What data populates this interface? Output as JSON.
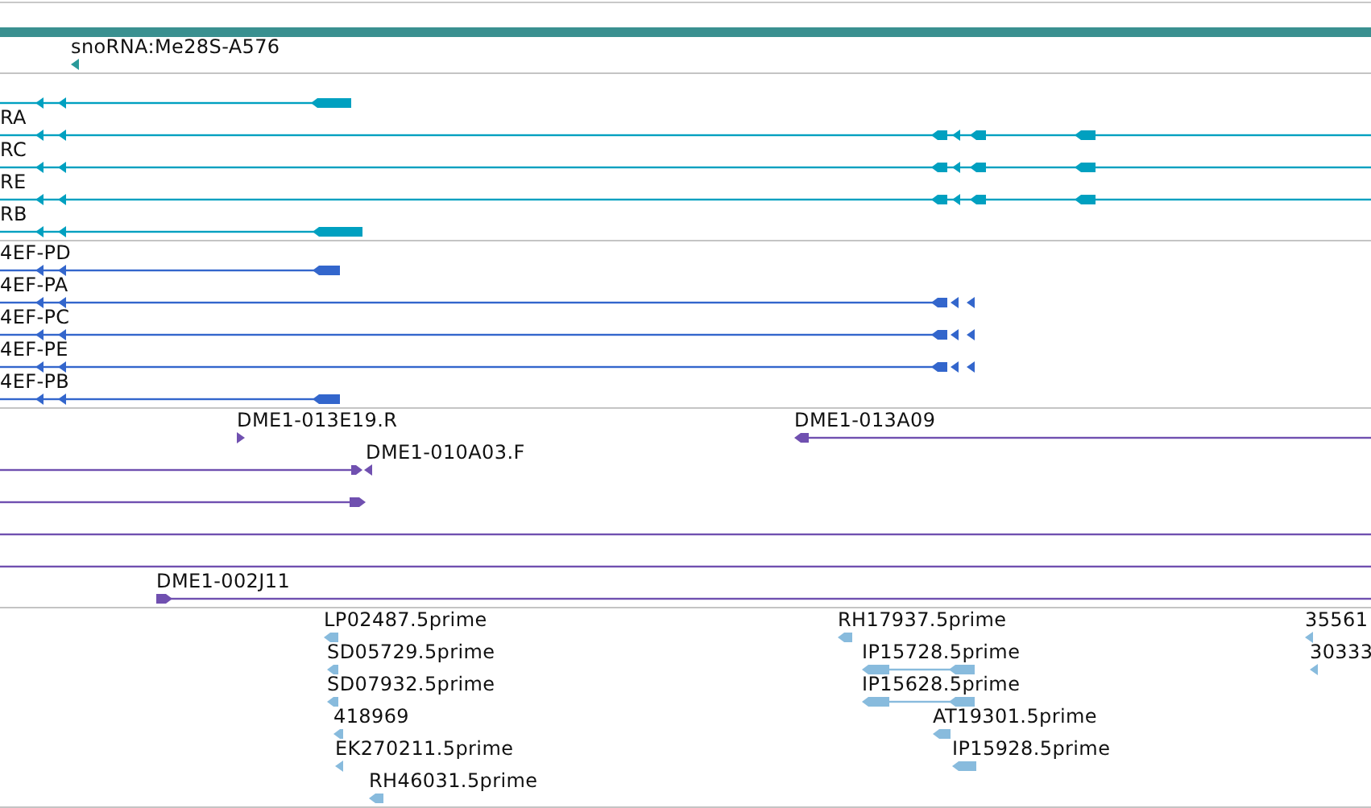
{
  "overview": {
    "color": "#3a9090"
  },
  "tracks": [
    {
      "color": "#2a9a9a",
      "features": [
        {
          "label": "snoRNA:Me28S-A576"
        }
      ]
    },
    {
      "color": "#00a0c0",
      "features": [
        {
          "label": "RA"
        },
        {
          "label": "RC"
        },
        {
          "label": "RE"
        },
        {
          "label": "RB"
        }
      ]
    },
    {
      "color": "#3366cc",
      "features": [
        {
          "label": "4EF-PD"
        },
        {
          "label": "4EF-PA"
        },
        {
          "label": "4EF-PC"
        },
        {
          "label": "4EF-PE"
        },
        {
          "label": "4EF-PB"
        }
      ]
    },
    {
      "color": "#7050b0",
      "features": [
        {
          "label": "DME1-013E19.R"
        },
        {
          "label": "DME1-013A09"
        },
        {
          "label": "DME1-010A03.F"
        },
        {
          "label": "DME1-002J11"
        }
      ]
    },
    {
      "color": "#88bbdd",
      "features": [
        {
          "label": "LP02487.5prime"
        },
        {
          "label": "SD05729.5prime"
        },
        {
          "label": "SD07932.5prime"
        },
        {
          "label": "418969"
        },
        {
          "label": "EK270211.5prime"
        },
        {
          "label": "RH46031.5prime"
        },
        {
          "label": "RH17937.5prime"
        },
        {
          "label": "IP15728.5prime"
        },
        {
          "label": "IP15628.5prime"
        },
        {
          "label": "AT19301.5prime"
        },
        {
          "label": "IP15928.5prime"
        },
        {
          "label": "35561"
        },
        {
          "label": "30333"
        }
      ]
    }
  ]
}
